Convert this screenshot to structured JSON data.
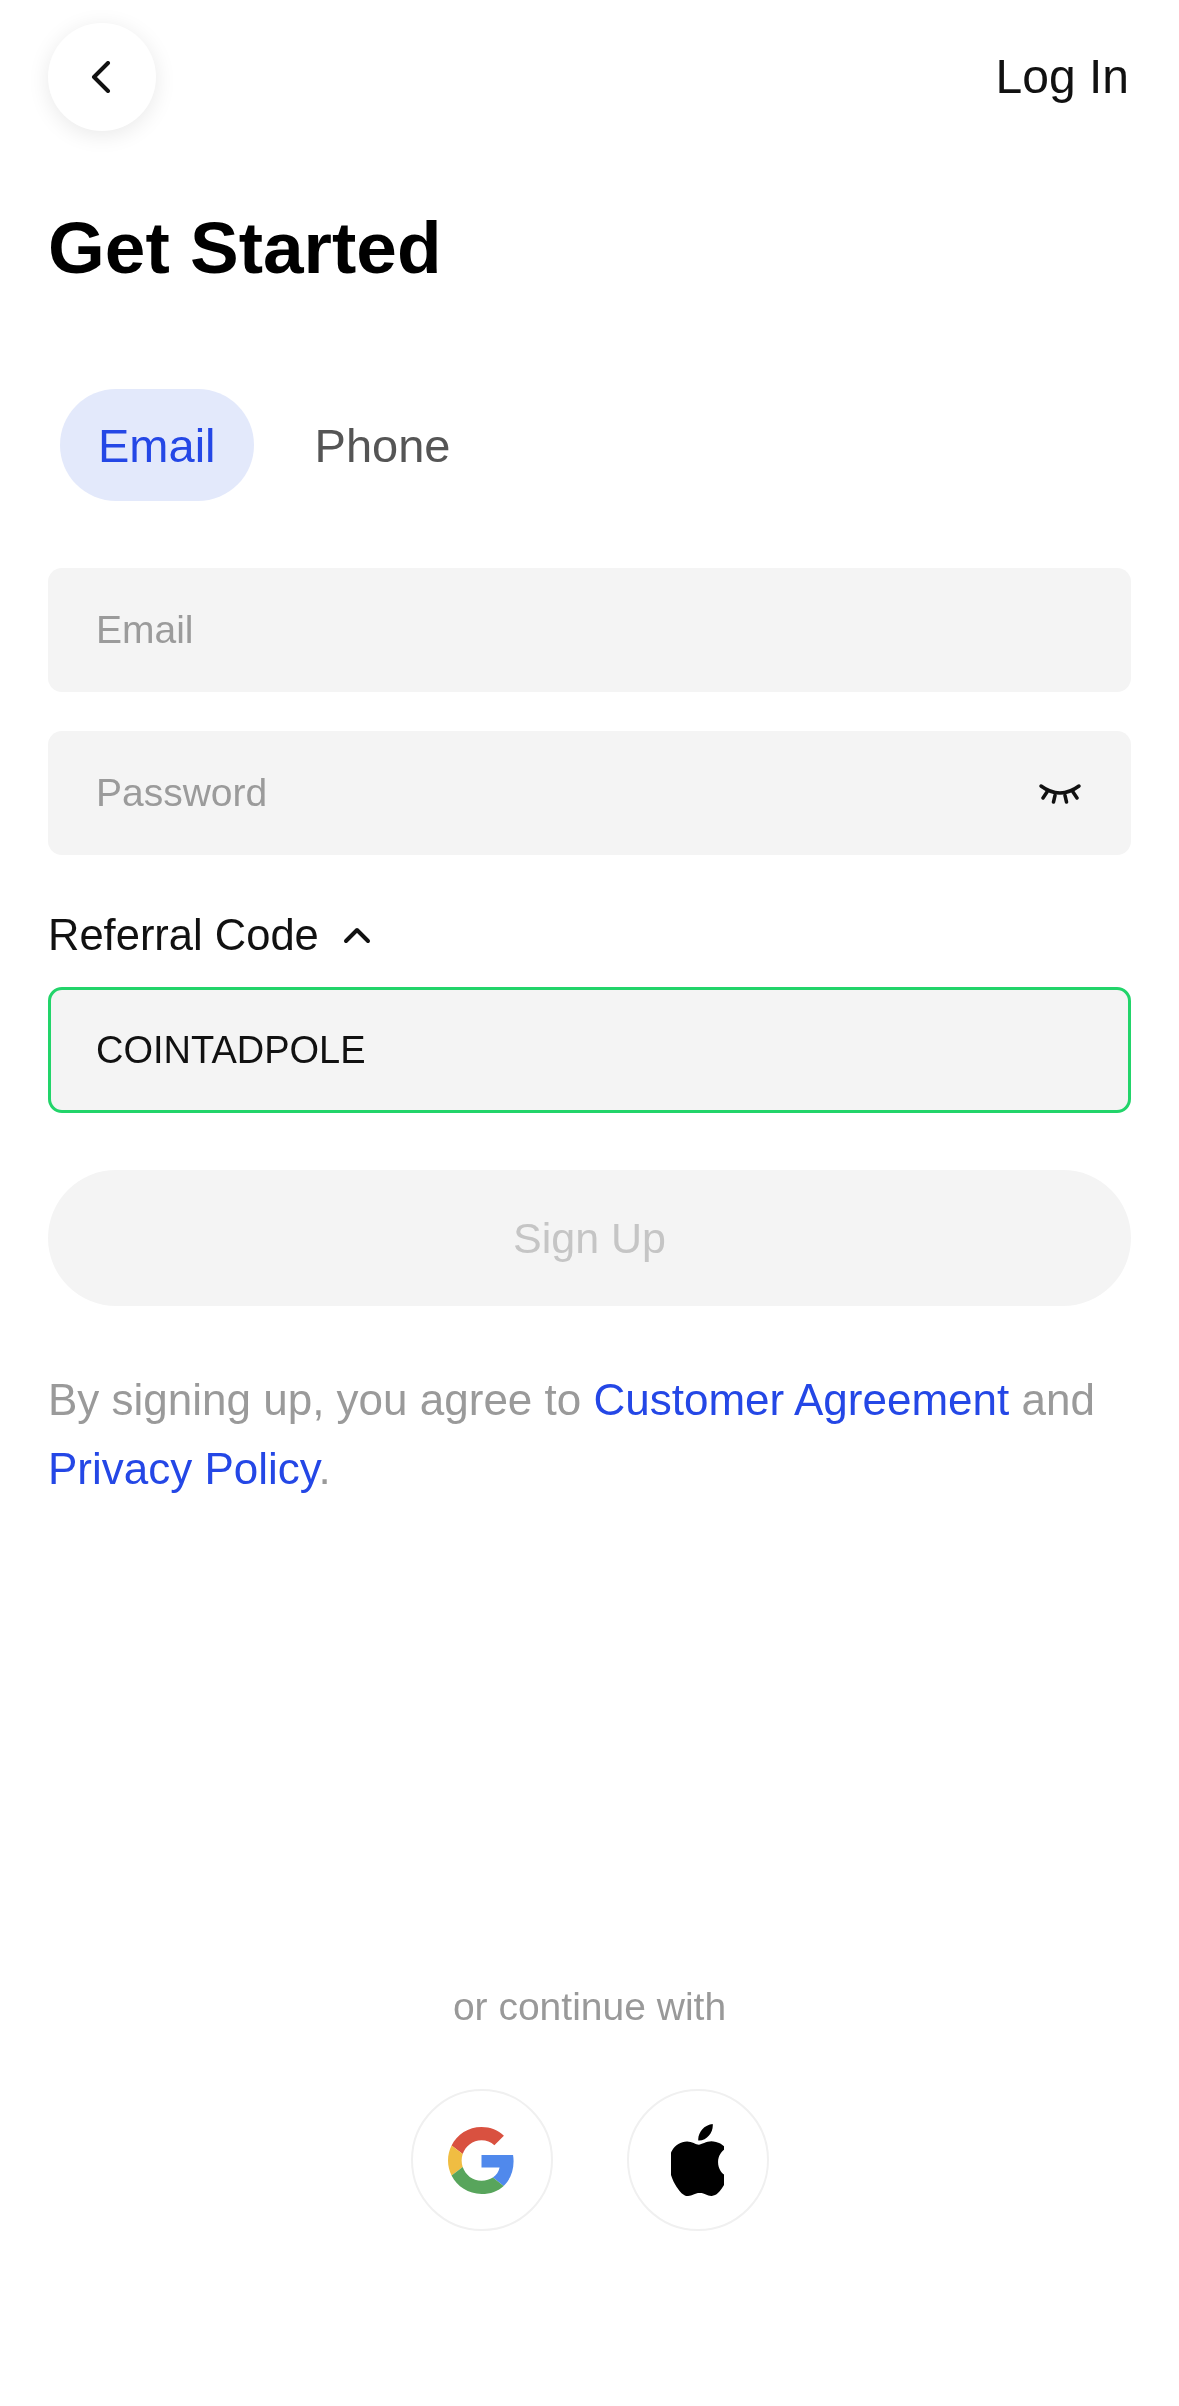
{
  "header": {
    "log_in_link": "Log In"
  },
  "title": "Get Started",
  "tabs": [
    {
      "label": "Email",
      "selected": true
    },
    {
      "label": "Phone",
      "selected": false
    }
  ],
  "fields": [
    {
      "kind": "email",
      "placeholder": "Email",
      "focused": false
    },
    {
      "kind": "password",
      "placeholder": "Password",
      "focused": false
    }
  ],
  "referral": {
    "label": "Referral Code",
    "expanded": true,
    "value": "COINTADPOLE",
    "focused": true
  },
  "sign_up_button": {
    "label": "Sign Up",
    "disabled": true
  },
  "terms": [
    {
      "kind": "text",
      "text": "By signing up, you agree to "
    },
    {
      "kind": "link",
      "text": "Customer Agreement"
    },
    {
      "kind": "text",
      "text": " and "
    },
    {
      "kind": "link",
      "text": "Privacy Policy"
    },
    {
      "kind": "text",
      "text": "."
    }
  ],
  "social": {
    "caption": "or continue with"
  }
}
